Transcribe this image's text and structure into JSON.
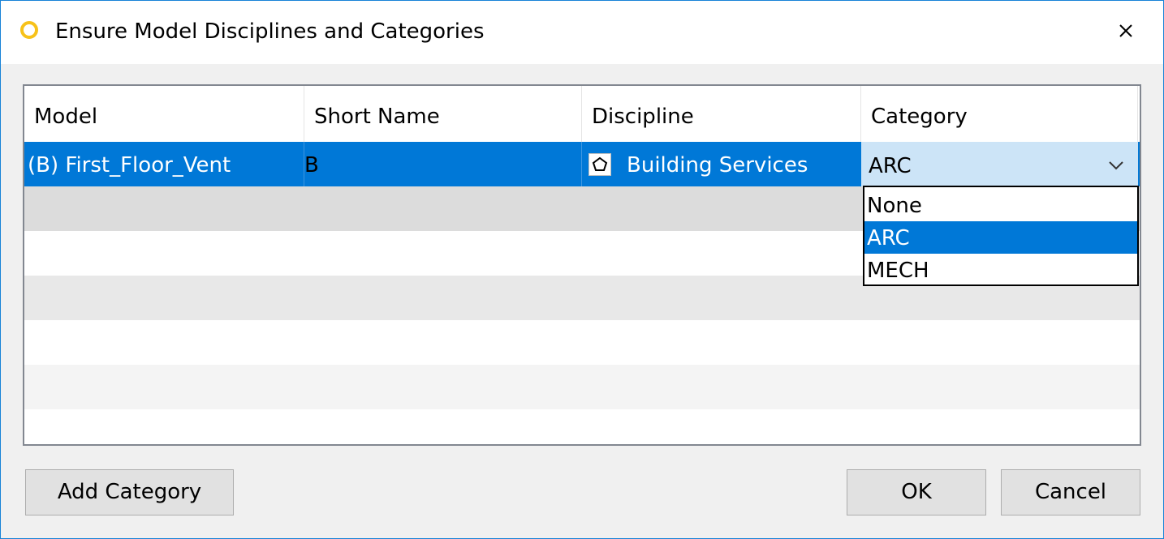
{
  "window": {
    "title": "Ensure Model Disciplines and Categories"
  },
  "grid": {
    "columns": [
      "Model",
      "Short Name",
      "Discipline",
      "Category"
    ],
    "rows": [
      {
        "model": "(B) First_Floor_Vent",
        "short_name": "B",
        "discipline": "Building Services",
        "category": "ARC"
      }
    ]
  },
  "category_dropdown": {
    "selected": "ARC",
    "options": [
      "None",
      "ARC",
      "MECH"
    ]
  },
  "buttons": {
    "add_category": "Add Category",
    "ok": "OK",
    "cancel": "Cancel"
  },
  "colors": {
    "selection": "#0078d7",
    "combo_background": "#cce4f7",
    "window_border": "#1883d7",
    "app_icon": "#f7c21a"
  },
  "icons": {
    "app": "yellow-ring-icon",
    "close": "close-icon",
    "discipline": "pentagon-icon",
    "dropdown": "chevron-down-icon"
  }
}
